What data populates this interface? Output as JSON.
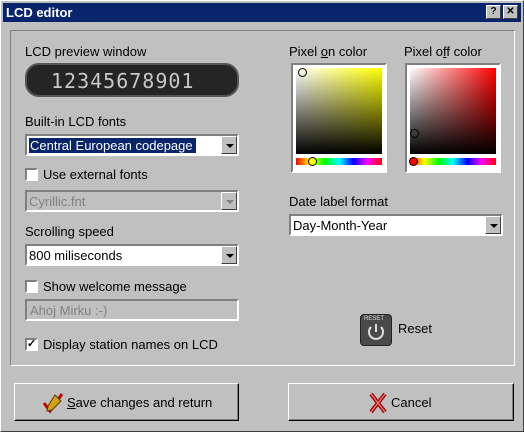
{
  "window": {
    "title": "LCD editor",
    "help_glyph": "?",
    "close_glyph": "✕"
  },
  "lcd_preview": {
    "label": "LCD preview window",
    "text": "12345678901"
  },
  "builtin_fonts": {
    "label": "Built-in LCD fonts",
    "value": "Central European codepage"
  },
  "external_fonts": {
    "label": "Use external fonts",
    "checked": false,
    "value": "Cyrillic.fnt"
  },
  "scrolling": {
    "label": "Scrolling speed",
    "value": "800 miliseconds"
  },
  "welcome": {
    "label": "Show welcome message",
    "checked": false,
    "value": "Ahoj Mirku :-)"
  },
  "station_names": {
    "label": "Display station names on LCD",
    "checked": true,
    "check_glyph": "✓"
  },
  "pixel_on": {
    "label_pre": "Pixel ",
    "label_u": "o",
    "label_post": "n color",
    "hue": "#ffff00"
  },
  "pixel_off": {
    "label_pre": "Pixel o",
    "label_u": "f",
    "label_post": "f color",
    "hue": "#ff0000"
  },
  "date_format": {
    "label": "Date label format",
    "value": "Day-Month-Year"
  },
  "reset": {
    "label": "Reset",
    "icon_text": "RESET"
  },
  "save": {
    "label_u": "S",
    "label_rest": "ave changes and return"
  },
  "cancel": {
    "label": "Cancel"
  }
}
